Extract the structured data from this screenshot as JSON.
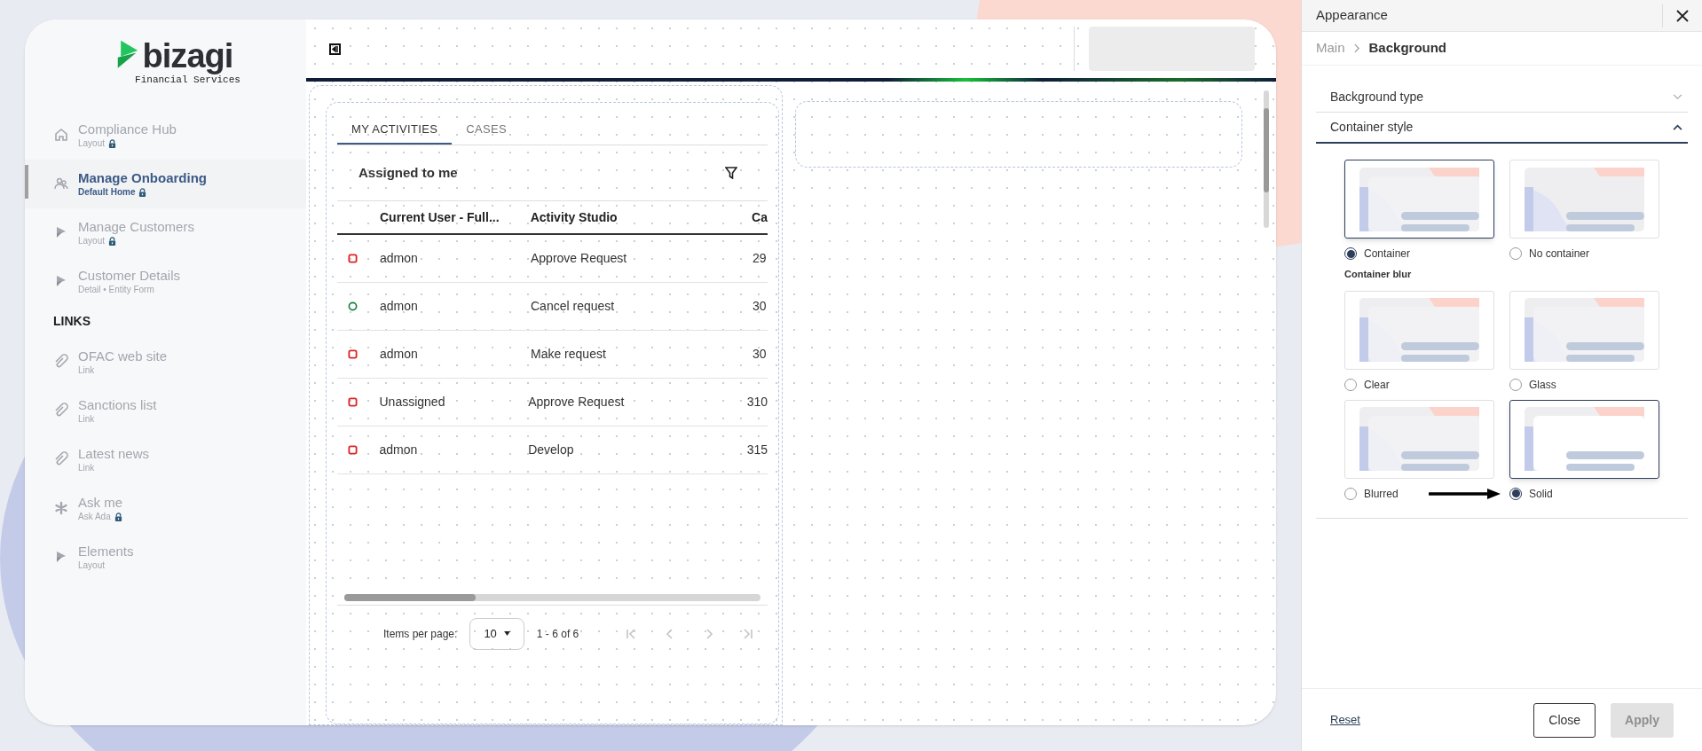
{
  "sidebar": {
    "logo": {
      "name": "bizagi",
      "subtitle": "Financial Services"
    },
    "groups": [
      {
        "items": [
          {
            "title": "Compliance Hub",
            "subtitle": "Layout",
            "locked": true,
            "selected": false
          },
          {
            "title": "Manage Onboarding",
            "subtitle": "Default Home",
            "locked": true,
            "selected": true
          },
          {
            "title": "Manage Customers",
            "subtitle": "Layout",
            "locked": true,
            "selected": false
          },
          {
            "title": "Customer Details",
            "subtitle": "Detail • Entity Form",
            "locked": false,
            "selected": false
          }
        ]
      },
      {
        "heading": "LINKS",
        "items": [
          {
            "title": "OFAC web site",
            "subtitle": "Link",
            "locked": false,
            "selected": false
          },
          {
            "title": "Sanctions list",
            "subtitle": "Link",
            "locked": false,
            "selected": false
          },
          {
            "title": "Latest news",
            "subtitle": "Link",
            "locked": false,
            "selected": false
          },
          {
            "title": "Ask me",
            "subtitle": "Ask Ada",
            "locked": true,
            "selected": false
          },
          {
            "title": "Elements",
            "subtitle": "Layout",
            "locked": false,
            "selected": false
          }
        ]
      }
    ]
  },
  "main": {
    "tabs": [
      {
        "label": "MY ACTIVITIES",
        "selected": true
      },
      {
        "label": "CASES",
        "selected": false
      }
    ],
    "list_title": "Assigned to me",
    "table": {
      "columns": [
        "Current User - Full...",
        "Activity Studio",
        "Ca"
      ],
      "rows": [
        {
          "kind": "late",
          "cells": [
            "admon",
            "Approve Request",
            "29"
          ]
        },
        {
          "kind": "on_time",
          "cells": [
            "admon",
            "Cancel request",
            "30"
          ]
        },
        {
          "kind": "late",
          "cells": [
            "admon",
            "Make request",
            "30"
          ]
        },
        {
          "kind": "late",
          "cells": [
            "Unassigned",
            "Approve Request",
            "310"
          ]
        },
        {
          "kind": "late",
          "cells": [
            "admon",
            "Develop",
            "315"
          ]
        }
      ]
    },
    "pagination": {
      "label": "Items per page:",
      "page_size": "10",
      "range": "1 - 6 of 6"
    }
  },
  "panel": {
    "title": "Appearance",
    "breadcrumb": [
      "Main",
      "Background"
    ],
    "sections": [
      {
        "title": "Background type",
        "expanded": false
      },
      {
        "title": "Container style",
        "expanded": true
      }
    ],
    "style_options": [
      {
        "label": "Container",
        "selected": true
      },
      {
        "label": "No container",
        "selected": false
      }
    ],
    "blur_heading": "Container blur",
    "blur_options": [
      {
        "label": "Clear",
        "selected": false
      },
      {
        "label": "Glass",
        "selected": false
      },
      {
        "label": "Blurred",
        "selected": false
      },
      {
        "label": "Solid",
        "selected": true
      }
    ],
    "reset": "Reset",
    "buttons": [
      {
        "label": "Close",
        "disabled": false
      },
      {
        "label": "Apply",
        "disabled": true
      }
    ]
  }
}
